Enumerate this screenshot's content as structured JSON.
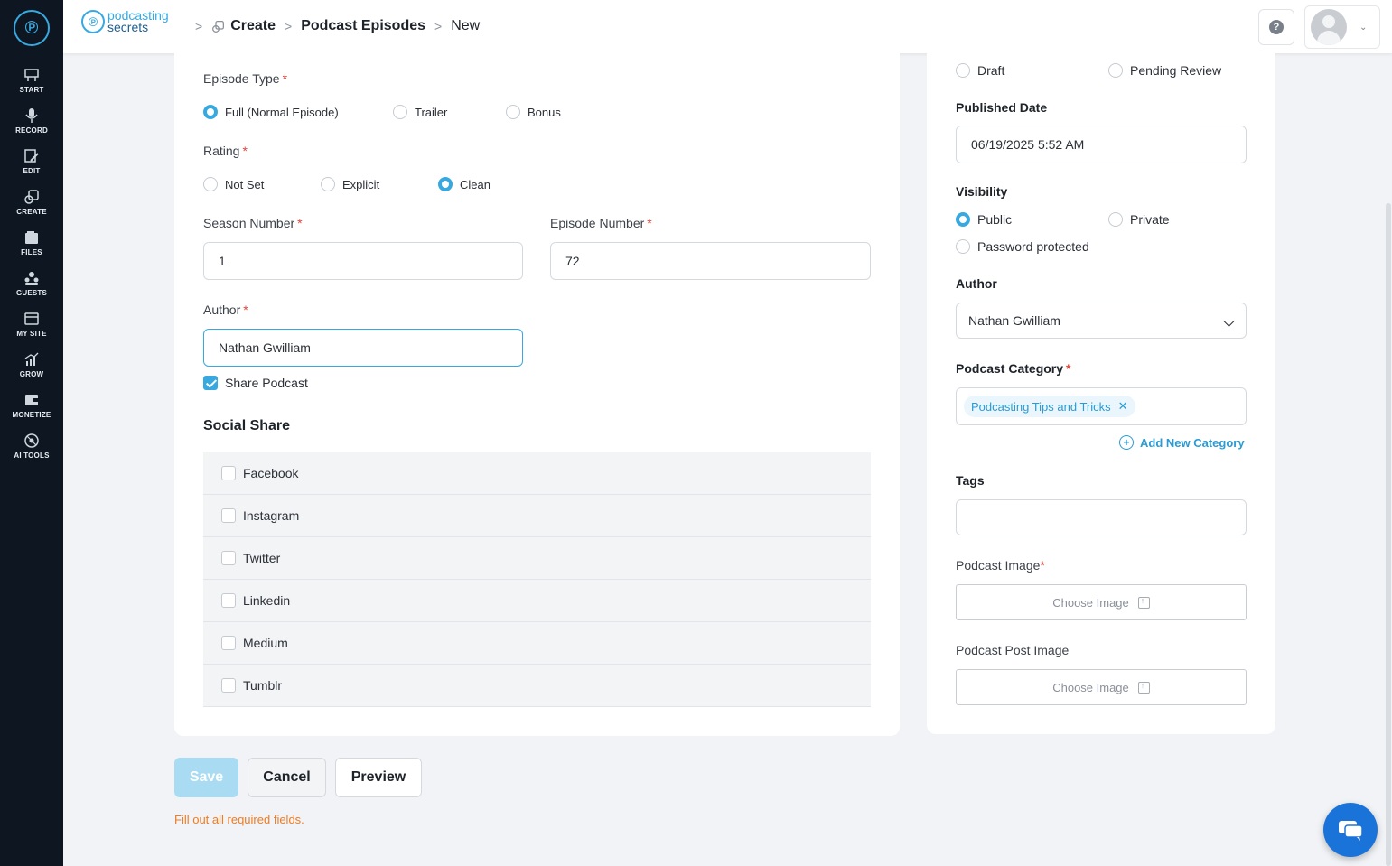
{
  "sidebar": {
    "items": [
      {
        "label": "START",
        "icon": "start-icon"
      },
      {
        "label": "RECORD",
        "icon": "microphone-icon"
      },
      {
        "label": "EDIT",
        "icon": "edit-icon"
      },
      {
        "label": "CREATE",
        "icon": "create-icon"
      },
      {
        "label": "FILES",
        "icon": "files-icon"
      },
      {
        "label": "GUESTS",
        "icon": "guests-icon"
      },
      {
        "label": "MY SITE",
        "icon": "site-icon"
      },
      {
        "label": "GROW",
        "icon": "grow-icon"
      },
      {
        "label": "MONETIZE",
        "icon": "monetize-icon"
      },
      {
        "label": "AI TOOLS",
        "icon": "ai-tools-icon"
      }
    ]
  },
  "header": {
    "brand_line1": "podcasting",
    "brand_line2": "secrets",
    "breadcrumb": [
      "Create",
      "Podcast Episodes",
      "New"
    ],
    "help_symbol": "?"
  },
  "form": {
    "episode_type": {
      "label": "Episode Type",
      "options": [
        "Full (Normal Episode)",
        "Trailer",
        "Bonus"
      ],
      "selected": "Full (Normal Episode)"
    },
    "rating": {
      "label": "Rating",
      "options": [
        "Not Set",
        "Explicit",
        "Clean"
      ],
      "selected": "Clean"
    },
    "season_number": {
      "label": "Season Number",
      "value": "1"
    },
    "episode_number": {
      "label": "Episode Number",
      "value": "72"
    },
    "author": {
      "label": "Author",
      "value": "Nathan Gwilliam"
    },
    "share_podcast": {
      "label": "Share Podcast",
      "checked": true
    },
    "social_share": {
      "title": "Social Share",
      "items": [
        "Facebook",
        "Instagram",
        "Twitter",
        "Linkedin",
        "Medium",
        "Tumblr"
      ]
    }
  },
  "side": {
    "status": {
      "options": [
        "Draft",
        "Pending Review"
      ]
    },
    "published_date": {
      "label": "Published Date",
      "value": "06/19/2025 5:52 AM"
    },
    "visibility": {
      "label": "Visibility",
      "options": [
        "Public",
        "Private",
        "Password protected"
      ],
      "selected": "Public"
    },
    "author": {
      "label": "Author",
      "value": "Nathan Gwilliam"
    },
    "category": {
      "label": "Podcast Category",
      "chip": "Podcasting Tips and Tricks",
      "add_label": "Add New Category"
    },
    "tags": {
      "label": "Tags",
      "value": ""
    },
    "podcast_image": {
      "label": "Podcast Image",
      "button": "Choose Image"
    },
    "post_image": {
      "label": "Podcast Post Image",
      "button": "Choose Image"
    }
  },
  "actions": {
    "save": "Save",
    "cancel": "Cancel",
    "preview": "Preview",
    "error": "Fill out all required fields."
  },
  "colors": {
    "accent": "#38a9e0",
    "sidebar": "#0e1621",
    "error": "#f07b22",
    "required": "#e0433c",
    "chat": "#1a73d9"
  }
}
